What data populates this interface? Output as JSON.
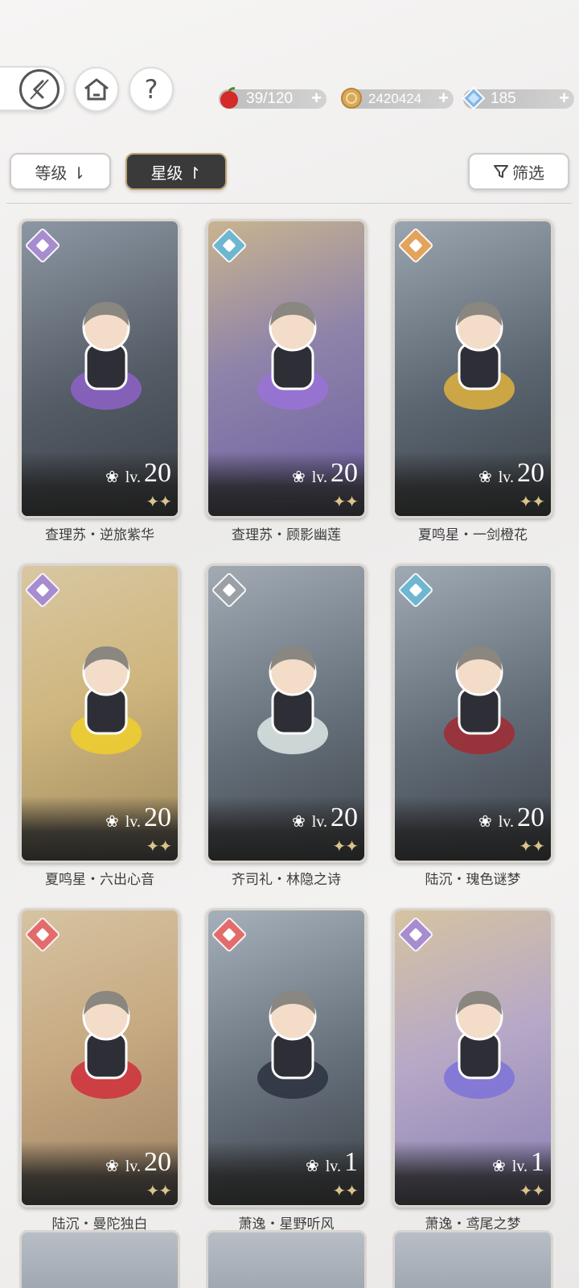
{
  "header": {
    "stamina": "39/120",
    "coins": "2420424",
    "gems": "185",
    "plus": "+",
    "help": "?"
  },
  "sort": {
    "level_label": "等级 ⇂",
    "star_label": "星级 ↾",
    "filter_label": "筛选"
  },
  "colors": {
    "accent_gold": "#bfa574",
    "selected_bg": "#3a3a3a"
  },
  "cards": [
    {
      "name": "查理苏・逆旅紫华",
      "level": "20",
      "lv": "lv.",
      "stars": "✦✦",
      "attr_color": "#a78ccf",
      "art": "linear-gradient(160deg,#8d97a3,#545c66 55%,#3a3f47)",
      "accent": "#8e62c9"
    },
    {
      "name": "查理苏・顾影幽莲",
      "level": "20",
      "lv": "lv.",
      "stars": "✦✦",
      "attr_color": "#6fb6d0",
      "art": "linear-gradient(160deg,#c9b48f,#8e83a9 45%,#6e5fa3)",
      "accent": "#9a72d8"
    },
    {
      "name": "夏鸣星・一剑橙花",
      "level": "20",
      "lv": "lv.",
      "stars": "✦✦",
      "attr_color": "#e3a35a",
      "art": "linear-gradient(160deg,#9aa5b0,#5b6670 55%,#3b4148)",
      "accent": "#e0b23e"
    },
    {
      "name": "夏鸣星・六出心音",
      "level": "20",
      "lv": "lv.",
      "stars": "✦✦",
      "attr_color": "#a78ccf",
      "art": "linear-gradient(160deg,#d8c7a2,#cfb67e 45%,#a08a5f)",
      "accent": "#f1cf2d"
    },
    {
      "name": "齐司礼・林隐之诗",
      "level": "20",
      "lv": "lv.",
      "stars": "✦✦",
      "attr_color": "#9aa0a6",
      "art": "linear-gradient(160deg,#a2abb4,#66707a 55%,#3f454c)",
      "accent": "#dfe9e6"
    },
    {
      "name": "陆沉・瑰色谜梦",
      "level": "20",
      "lv": "lv.",
      "stars": "✦✦",
      "attr_color": "#6fb6d0",
      "art": "linear-gradient(160deg,#a0aab4,#616b76 55%,#3c4249)",
      "accent": "#a12a33"
    },
    {
      "name": "陆沉・曼陀独白",
      "level": "20",
      "lv": "lv.",
      "stars": "✦✦",
      "attr_color": "#e26c6c",
      "art": "linear-gradient(160deg,#d6c3a1,#c7aa82 45%,#9e8263)",
      "accent": "#cf2e3a"
    },
    {
      "name": "萧逸・星野听风",
      "level": "1",
      "lv": "lv.",
      "stars": "✦✦",
      "attr_color": "#e26c6c",
      "art": "linear-gradient(160deg,#a6b0ba,#66707b 55%,#3d434a)",
      "accent": "#2c3140"
    },
    {
      "name": "萧逸・鸢尾之梦",
      "level": "1",
      "lv": "lv.",
      "stars": "✦✦",
      "attr_color": "#a78ccf",
      "art": "linear-gradient(160deg,#d6c3a1,#b7a9c6 45%,#8a7fb6)",
      "accent": "#7d72d8"
    }
  ]
}
